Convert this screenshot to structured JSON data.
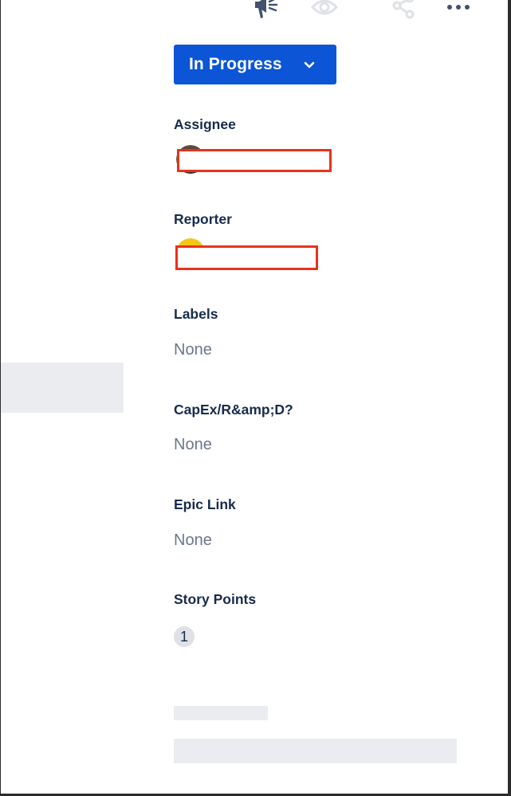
{
  "colors": {
    "primary_button": "#0b55d6",
    "label_text": "#172b4d",
    "muted_text": "#6b778c",
    "skeleton": "#ebecf0",
    "redaction_border": "#e8321b",
    "badge_bg": "#dfe1e6"
  },
  "toolbar": {
    "icons": [
      "megaphone-icon",
      "eye-icon",
      "share-icon",
      "more-icon"
    ]
  },
  "status": {
    "label": "In Progress",
    "icon": "chevron-down-icon"
  },
  "fields": {
    "assignee": {
      "label": "Assignee",
      "value": ""
    },
    "reporter": {
      "label": "Reporter",
      "value": ""
    },
    "labels": {
      "label": "Labels",
      "value": "None"
    },
    "capex": {
      "label": "CapEx/R&amp;D?",
      "value": "None"
    },
    "epic_link": {
      "label": "Epic Link",
      "value": "None"
    },
    "story_points": {
      "label": "Story Points",
      "value": "1"
    }
  }
}
